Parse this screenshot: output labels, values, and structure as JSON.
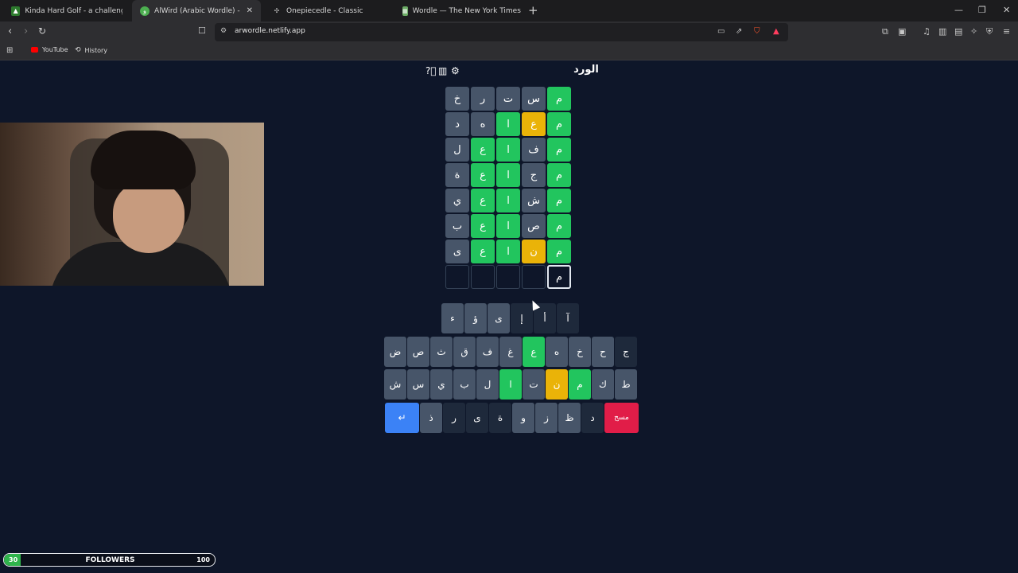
{
  "browser": {
    "tabs": [
      {
        "label": "Kinda Hard Golf - a challenging daily",
        "active": false,
        "favicon": "golf-icon"
      },
      {
        "label": "AlWird (Arabic Wordle) - الورد",
        "active": true,
        "favicon": "alwird-icon"
      },
      {
        "label": "Onepiecedle - Classic",
        "active": false,
        "favicon": "onepiece-icon"
      },
      {
        "label": "Wordle — The New York Times",
        "active": false,
        "favicon": "nyt-icon"
      }
    ],
    "url": "arwordle.netlify.app",
    "bookmarks": [
      {
        "label": "YouTube",
        "icon": "youtube-icon"
      },
      {
        "label": "History",
        "icon": "history-icon"
      }
    ]
  },
  "game": {
    "title": "الورد",
    "rows": [
      [
        {
          "l": "م",
          "s": "correct"
        },
        {
          "l": "س",
          "s": "absent"
        },
        {
          "l": "ت",
          "s": "absent"
        },
        {
          "l": "ر",
          "s": "absent"
        },
        {
          "l": "خ",
          "s": "absent"
        }
      ],
      [
        {
          "l": "م",
          "s": "correct"
        },
        {
          "l": "ع",
          "s": "present"
        },
        {
          "l": "ا",
          "s": "correct"
        },
        {
          "l": "ه",
          "s": "absent"
        },
        {
          "l": "د",
          "s": "absent"
        }
      ],
      [
        {
          "l": "م",
          "s": "correct"
        },
        {
          "l": "ف",
          "s": "absent"
        },
        {
          "l": "ا",
          "s": "correct"
        },
        {
          "l": "ع",
          "s": "correct"
        },
        {
          "l": "ل",
          "s": "absent"
        }
      ],
      [
        {
          "l": "م",
          "s": "correct"
        },
        {
          "l": "ج",
          "s": "absent"
        },
        {
          "l": "ا",
          "s": "correct"
        },
        {
          "l": "ع",
          "s": "correct"
        },
        {
          "l": "ة",
          "s": "absent"
        }
      ],
      [
        {
          "l": "م",
          "s": "correct"
        },
        {
          "l": "ش",
          "s": "absent"
        },
        {
          "l": "ا",
          "s": "correct"
        },
        {
          "l": "ع",
          "s": "correct"
        },
        {
          "l": "ي",
          "s": "absent"
        }
      ],
      [
        {
          "l": "م",
          "s": "correct"
        },
        {
          "l": "ص",
          "s": "absent"
        },
        {
          "l": "ا",
          "s": "correct"
        },
        {
          "l": "ع",
          "s": "correct"
        },
        {
          "l": "ب",
          "s": "absent"
        }
      ],
      [
        {
          "l": "م",
          "s": "correct"
        },
        {
          "l": "ن",
          "s": "present"
        },
        {
          "l": "ا",
          "s": "correct"
        },
        {
          "l": "ع",
          "s": "correct"
        },
        {
          "l": "ى",
          "s": "absent"
        }
      ],
      [
        {
          "l": "م",
          "s": "typed"
        },
        {
          "l": "",
          "s": "empty"
        },
        {
          "l": "",
          "s": "empty"
        },
        {
          "l": "",
          "s": "empty"
        },
        {
          "l": "",
          "s": "empty"
        }
      ]
    ],
    "keyboard": [
      [
        {
          "l": "آ",
          "s": "unused"
        },
        {
          "l": "أ",
          "s": "unused"
        },
        {
          "l": "إ",
          "s": "unused"
        },
        {
          "l": "ى",
          "s": "absent"
        },
        {
          "l": "ؤ",
          "s": "absent"
        },
        {
          "l": "ء",
          "s": "absent"
        }
      ],
      [
        {
          "l": "ج",
          "s": "unused"
        },
        {
          "l": "ح",
          "s": "absent"
        },
        {
          "l": "خ",
          "s": "absent"
        },
        {
          "l": "ه",
          "s": "absent"
        },
        {
          "l": "ع",
          "s": "correct"
        },
        {
          "l": "غ",
          "s": "absent"
        },
        {
          "l": "ف",
          "s": "absent"
        },
        {
          "l": "ق",
          "s": "absent"
        },
        {
          "l": "ث",
          "s": "absent"
        },
        {
          "l": "ص",
          "s": "absent"
        },
        {
          "l": "ض",
          "s": "absent"
        }
      ],
      [
        {
          "l": "ط",
          "s": "absent"
        },
        {
          "l": "ك",
          "s": "absent"
        },
        {
          "l": "م",
          "s": "correct"
        },
        {
          "l": "ن",
          "s": "present"
        },
        {
          "l": "ت",
          "s": "absent"
        },
        {
          "l": "ا",
          "s": "correct"
        },
        {
          "l": "ل",
          "s": "absent"
        },
        {
          "l": "ب",
          "s": "absent"
        },
        {
          "l": "ي",
          "s": "absent"
        },
        {
          "l": "س",
          "s": "absent"
        },
        {
          "l": "ش",
          "s": "absent"
        }
      ],
      [
        {
          "l": "مسح",
          "s": "del"
        },
        {
          "l": "د",
          "s": "unused"
        },
        {
          "l": "ظ",
          "s": "absent"
        },
        {
          "l": "ز",
          "s": "absent"
        },
        {
          "l": "و",
          "s": "absent"
        },
        {
          "l": "ة",
          "s": "unused"
        },
        {
          "l": "ى",
          "s": "unused"
        },
        {
          "l": "ر",
          "s": "unused"
        },
        {
          "l": "ذ",
          "s": "absent"
        },
        {
          "l": "↵",
          "s": "enter"
        }
      ]
    ]
  },
  "overlay": {
    "followers_label": "FOLLOWERS",
    "followers_current": "30",
    "followers_goal": "100",
    "followers_progress": 0.3
  }
}
